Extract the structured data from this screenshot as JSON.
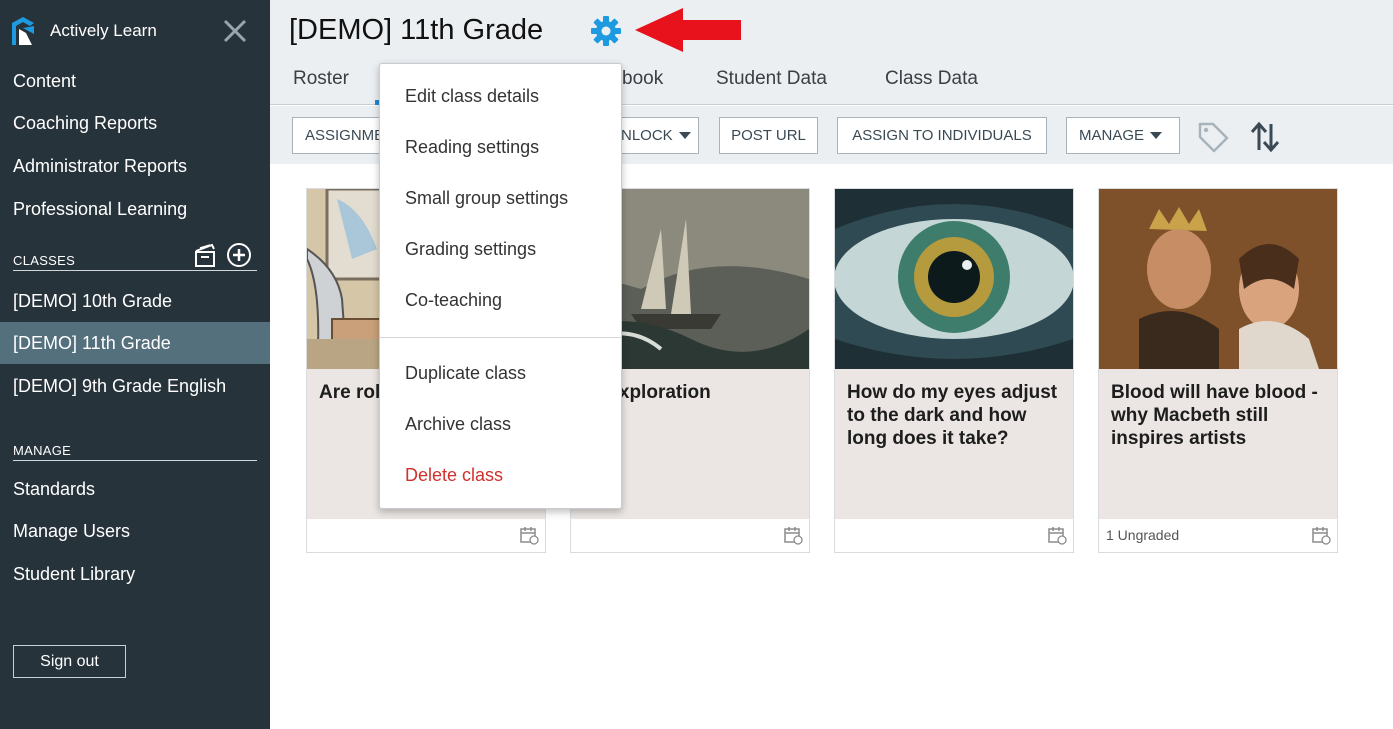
{
  "sidebar": {
    "brand": "Actively Learn",
    "nav": [
      "Content",
      "Coaching Reports",
      "Administrator Reports",
      "Professional Learning"
    ],
    "classes_heading": "CLASSES",
    "classes": [
      "[DEMO] 10th Grade",
      "[DEMO] 11th Grade",
      "[DEMO] 9th Grade English"
    ],
    "manage_heading": "MANAGE",
    "manage": [
      "Standards",
      "Manage Users",
      "Student Library"
    ],
    "signout": "Sign out"
  },
  "header": {
    "title": "[DEMO] 11th Grade",
    "tabs": [
      "Roster",
      "book",
      "Student Data",
      "Class Data"
    ]
  },
  "toolbar": {
    "assignments": "ASSIGNME",
    "unlock": "NLOCK",
    "post_url": "POST URL",
    "assign_individuals": "ASSIGN TO INDIVIDUALS",
    "manage": "MANAGE"
  },
  "cards": [
    {
      "title": "Are rol jobs?",
      "footer": ""
    },
    {
      "title": "of Exploration",
      "footer": ""
    },
    {
      "title": "How do my eyes adjust to the dark and how long does it take?",
      "footer": ""
    },
    {
      "title": "Blood will have blood - why Macbeth still inspires artists",
      "footer": "1 Ungraded"
    }
  ],
  "dropdown": {
    "items": [
      "Edit class details",
      "Reading settings",
      "Small group settings",
      "Grading settings",
      "Co-teaching"
    ],
    "items2": [
      "Duplicate class",
      "Archive class"
    ],
    "delete": "Delete class"
  },
  "colors": {
    "sidebar": "#27333b",
    "active_class": "#55707d",
    "accent": "#1e9be0",
    "arrow": "#e8121c",
    "danger": "#d0312d"
  },
  "icons": [
    "logo-icon",
    "close-icon",
    "archive-icon",
    "add-circle-icon",
    "gear-icon",
    "red-arrow-icon",
    "tag-icon",
    "sort-icon",
    "calendar-icon"
  ]
}
